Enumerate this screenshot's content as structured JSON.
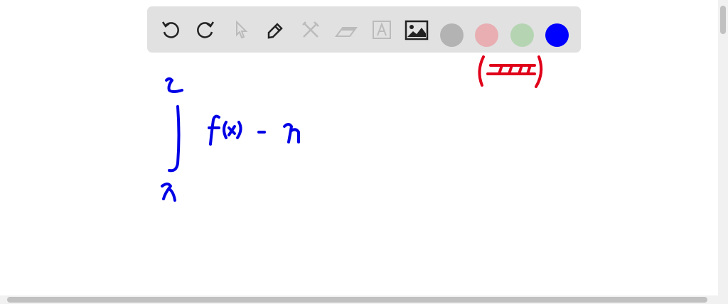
{
  "toolbar": {
    "tools": [
      "undo-icon",
      "redo-icon",
      "select-icon",
      "pen-icon",
      "tools-icon",
      "eraser-icon",
      "text-icon",
      "image-icon"
    ],
    "colors": [
      "#b3b3b3",
      "#e8aeb2",
      "#b5d5b2",
      "#0000ff"
    ],
    "selected_color": "#0000ff"
  },
  "ink": {
    "blue": "#0000e6",
    "red": "#e0001a"
  }
}
